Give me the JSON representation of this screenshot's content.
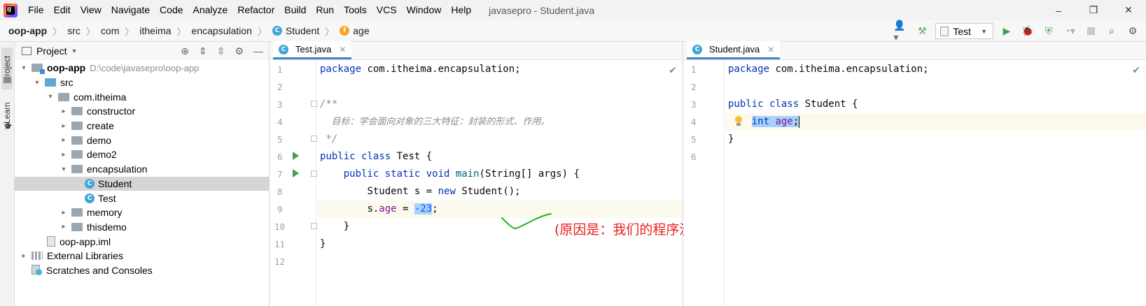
{
  "menubar": {
    "logo_text": "IJ",
    "items": [
      "File",
      "Edit",
      "View",
      "Navigate",
      "Code",
      "Analyze",
      "Refactor",
      "Build",
      "Run",
      "Tools",
      "VCS",
      "Window",
      "Help"
    ],
    "window_title": "javasepro - Student.java",
    "controls": {
      "minimize": "–",
      "restore": "❐",
      "close": "✕"
    }
  },
  "breadcrumb": {
    "items": [
      "oop-app",
      "src",
      "com",
      "itheima",
      "encapsulation",
      "Student",
      "age"
    ]
  },
  "toolbar": {
    "run_config": "Test",
    "icons": [
      "user-icon",
      "hammer-icon",
      "run-icon",
      "debug-icon",
      "coverage-icon",
      "profile-icon",
      "stop-icon",
      "search-icon",
      "settings-icon"
    ]
  },
  "stripe": {
    "project_tab": "Project",
    "learn_tab": "Learn"
  },
  "project_panel": {
    "title": "Project",
    "tree": [
      {
        "label": "oop-app",
        "extra": "D:\\code\\javasepro\\oop-app",
        "indent": 0,
        "arrow": "▾",
        "icon": "module-folder",
        "bold": true
      },
      {
        "label": "src",
        "indent": 1,
        "arrow": "▾",
        "icon": "source-folder"
      },
      {
        "label": "com.itheima",
        "indent": 2,
        "arrow": "▾",
        "icon": "package"
      },
      {
        "label": "constructor",
        "indent": 3,
        "arrow": "▸",
        "icon": "package"
      },
      {
        "label": "create",
        "indent": 3,
        "arrow": "▸",
        "icon": "package"
      },
      {
        "label": "demo",
        "indent": 3,
        "arrow": "▸",
        "icon": "package"
      },
      {
        "label": "demo2",
        "indent": 3,
        "arrow": "▸",
        "icon": "package"
      },
      {
        "label": "encapsulation",
        "indent": 3,
        "arrow": "▾",
        "icon": "package"
      },
      {
        "label": "Student",
        "indent": 4,
        "arrow": "",
        "icon": "class",
        "selected": true
      },
      {
        "label": "Test",
        "indent": 4,
        "arrow": "",
        "icon": "class-run"
      },
      {
        "label": "memory",
        "indent": 3,
        "arrow": "▸",
        "icon": "package"
      },
      {
        "label": "thisdemo",
        "indent": 3,
        "arrow": "▸",
        "icon": "package"
      },
      {
        "label": "oop-app.iml",
        "indent": 2,
        "arrow": "",
        "icon": "iml"
      },
      {
        "label": "External Libraries",
        "indent": 0,
        "arrow": "▸",
        "icon": "libs"
      },
      {
        "label": "Scratches and Consoles",
        "indent": 0,
        "arrow": "",
        "icon": "scratch"
      }
    ]
  },
  "editor_left": {
    "tab": "Test.java",
    "line_numbers": [
      "1",
      "2",
      "3",
      "4",
      "5",
      "6",
      "7",
      "8",
      "9",
      "10",
      "11",
      "12"
    ],
    "code": {
      "l1_kw": "package",
      "l1_rest": " com.itheima.encapsulation;",
      "l3": "/**",
      "l4": "    目标：学会面向对象的三大特征：封装的形式、作用。",
      "l5": " */",
      "l6_kw": "public class",
      "l6_rest": " Test {",
      "l7_kw": "public static void",
      "l7_fn": "main",
      "l7_rest": "(String[] args) {",
      "l8_a": "Student s = ",
      "l8_kw": "new",
      "l8_b": " Student();",
      "l9_a": "s.",
      "l9_fld": "age",
      "l9_b": " = ",
      "l9_num": "-23",
      "l9_c": ";",
      "l10": "}",
      "l11": "}"
    },
    "annotation": "(原因是：我们的程序没有对所用的对象进行封装)"
  },
  "editor_right": {
    "tab": "Student.java",
    "line_numbers": [
      "1",
      "2",
      "3",
      "4",
      "5",
      "6"
    ],
    "code": {
      "l1_kw": "package",
      "l1_rest": " com.itheima.encapsulation;",
      "l3_kw": "public class",
      "l3_rest": " Student {",
      "l4_kw": "int",
      "l4_fld": "age",
      "l4_semi": ";",
      "l5": "}"
    }
  },
  "colors": {
    "keyword": "#0033b3",
    "field": "#871094",
    "number": "#1750eb",
    "selection": "#a6d2ff",
    "annotation": "#e8201e",
    "check": "#59a869"
  }
}
